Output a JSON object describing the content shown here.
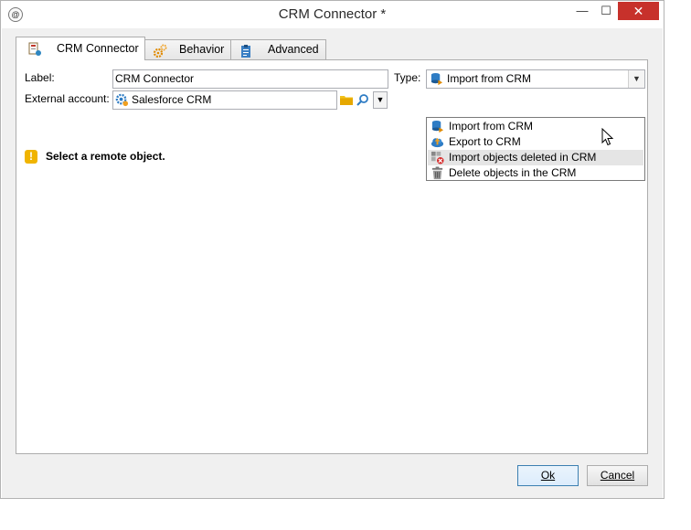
{
  "window": {
    "title": "CRM Connector *",
    "minimize_glyph": "—",
    "maximize_glyph": "☐",
    "close_glyph": "✕",
    "app_icon_glyph": "@"
  },
  "tabs": [
    {
      "label": "CRM Connector",
      "icon": "crm-connector-icon",
      "active": true
    },
    {
      "label": "Behavior",
      "icon": "gears-icon",
      "active": false
    },
    {
      "label": "Advanced",
      "icon": "clipboard-icon",
      "active": false
    }
  ],
  "form": {
    "label_caption": "Label:",
    "label_value": "CRM Connector",
    "account_caption": "External account:",
    "account_value": "Salesforce CRM",
    "type_caption": "Type:",
    "type_value": "Import from CRM"
  },
  "type_options": [
    {
      "label": "Import from CRM",
      "icon": "database-import-icon",
      "highlighted": false
    },
    {
      "label": "Export to CRM",
      "icon": "cloud-export-icon",
      "highlighted": false
    },
    {
      "label": "Import objects deleted in CRM",
      "icon": "deleted-objects-icon",
      "highlighted": true
    },
    {
      "label": "Delete objects in the CRM",
      "icon": "trash-icon",
      "highlighted": false
    }
  ],
  "warning": {
    "text": "Select a remote object.",
    "glyph": "!"
  },
  "buttons": {
    "ok": "Ok",
    "cancel": "Cancel"
  },
  "colors": {
    "close_button": "#c7312b",
    "warning": "#f0b400",
    "highlight": "#e5e5e5"
  }
}
